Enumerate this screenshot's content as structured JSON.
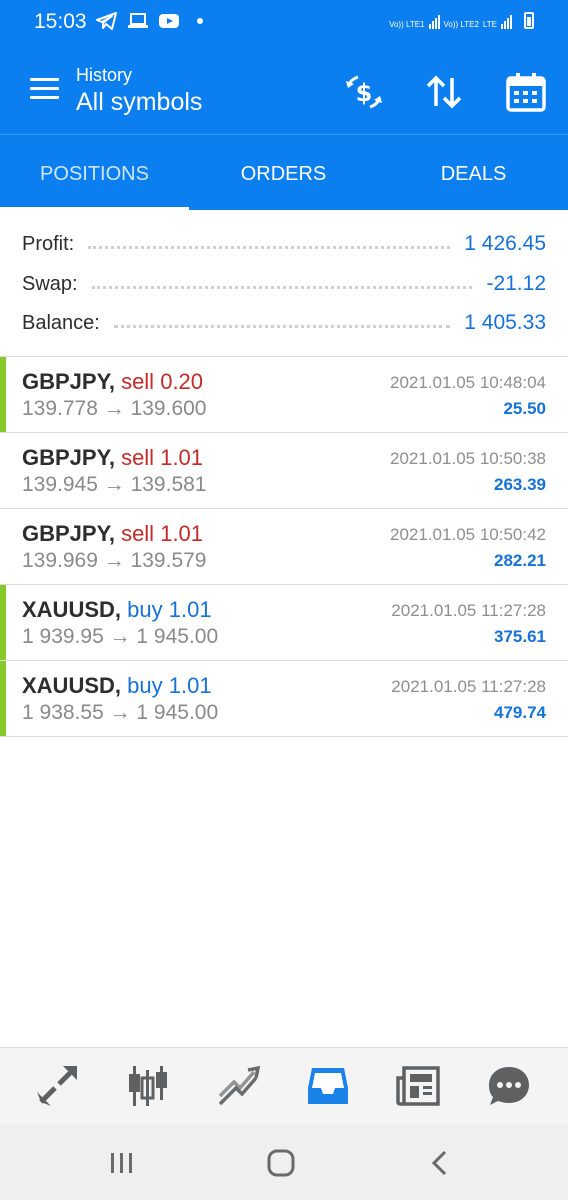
{
  "status_bar": {
    "time": "15:03",
    "network_1": "Vo)) LTE1",
    "network_2": "Vo)) LTE2",
    "lte": "LTE"
  },
  "app_bar": {
    "subtitle": "History",
    "title": "All symbols",
    "icons": [
      "menu-icon",
      "currency-exchange-icon",
      "sort-icon",
      "calendar-icon"
    ]
  },
  "tabs": [
    {
      "label": "POSITIONS",
      "active": true
    },
    {
      "label": "ORDERS",
      "active": false
    },
    {
      "label": "DEALS",
      "active": false
    }
  ],
  "summary": {
    "profit_label": "Profit:",
    "profit_value": "1 426.45",
    "swap_label": "Swap:",
    "swap_value": "-21.12",
    "balance_label": "Balance:",
    "balance_value": "1 405.33"
  },
  "deals": [
    {
      "symbol": "GBPJPY,",
      "side": "sell",
      "volume": "0.20",
      "prices": "139.778 → 139.600",
      "time": "2021.01.05 10:48:04",
      "profit": "25.50",
      "marked": true
    },
    {
      "symbol": "GBPJPY,",
      "side": "sell",
      "volume": "1.01",
      "prices": "139.945 → 139.581",
      "time": "2021.01.05 10:50:38",
      "profit": "263.39",
      "marked": false
    },
    {
      "symbol": "GBPJPY,",
      "side": "sell",
      "volume": "1.01",
      "prices": "139.969 → 139.579",
      "time": "2021.01.05 10:50:42",
      "profit": "282.21",
      "marked": false
    },
    {
      "symbol": "XAUUSD,",
      "side": "buy",
      "volume": "1.01",
      "prices": "1 939.95 → 1 945.00",
      "time": "2021.01.05 11:27:28",
      "profit": "375.61",
      "marked": true
    },
    {
      "symbol": "XAUUSD,",
      "side": "buy",
      "volume": "1.01",
      "prices": "1 938.55 → 1 945.00",
      "time": "2021.01.05 11:27:28",
      "profit": "479.74",
      "marked": true
    }
  ],
  "bottom_nav": {
    "items": [
      "quotes-icon",
      "chart-icon",
      "trade-icon",
      "history-icon",
      "news-icon",
      "chat-icon"
    ],
    "active_item": "history-icon"
  },
  "colors": {
    "primary": "#0c7ff0",
    "profit_blue": "#1671d8",
    "sell_red": "#c42a2a",
    "marker_green": "#86c92b"
  }
}
